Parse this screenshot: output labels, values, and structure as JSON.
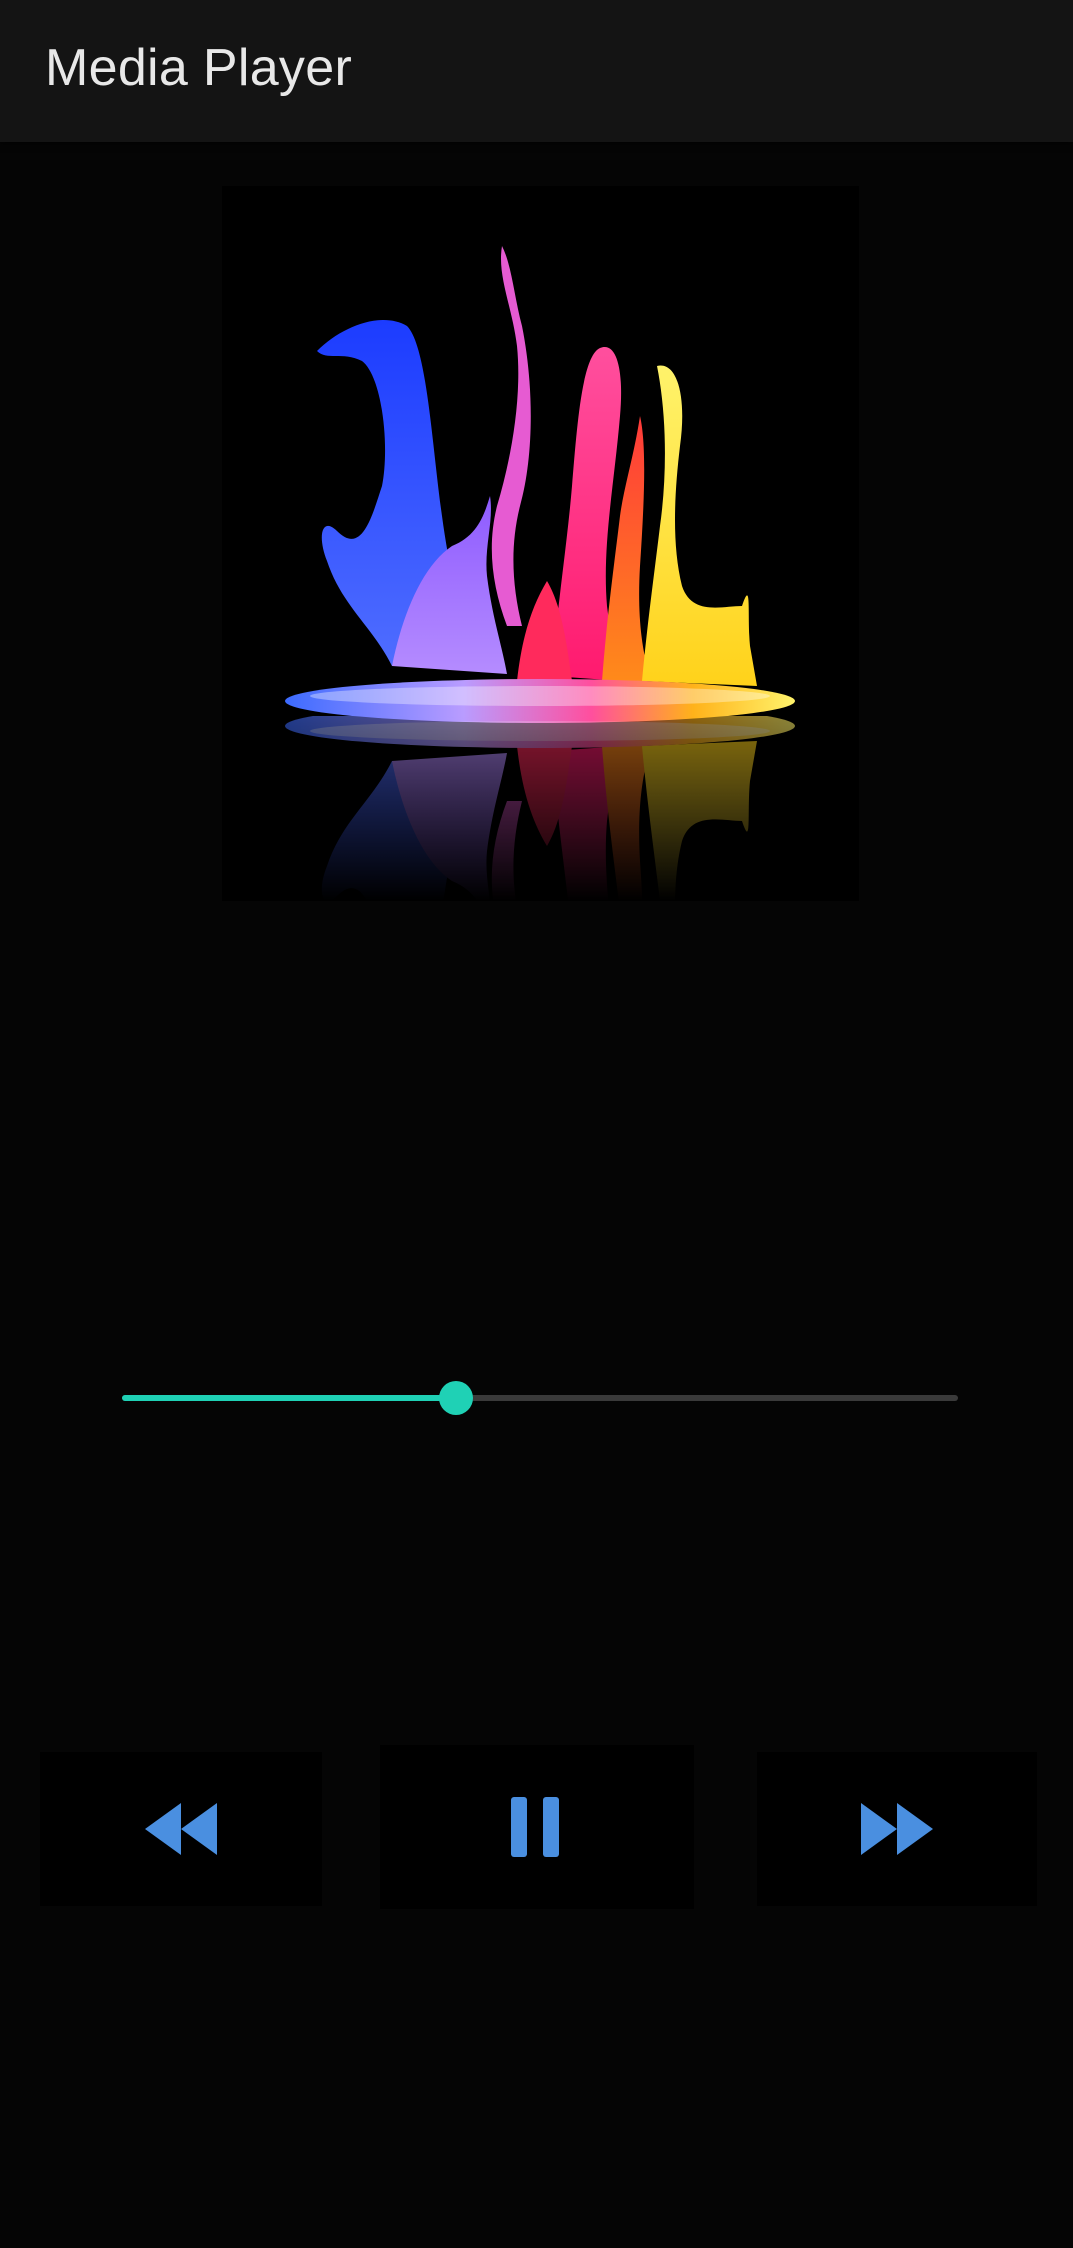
{
  "app": {
    "title": "Media Player"
  },
  "now_playing": {
    "artwork": "paint-splash-album-art"
  },
  "player": {
    "progress_fraction": 0.4
  },
  "controls": {
    "rewind_icon": "rewind-icon",
    "pause_icon": "pause-icon",
    "forward_icon": "fast-forward-icon",
    "icon_color": "#4a8fe0"
  },
  "colors": {
    "background": "#050505",
    "app_bar": "#141414",
    "accent": "#1fd1b5",
    "track": "#3a3a3a"
  }
}
